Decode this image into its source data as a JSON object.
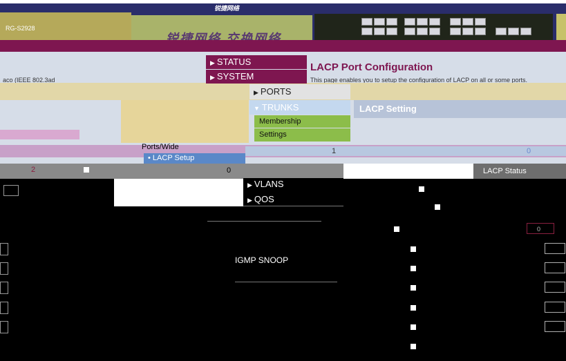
{
  "header": {
    "logo_text": "锐捷网络",
    "brand_text": "锐捷网络 交换网络",
    "product_name": "RG-S2928"
  },
  "page": {
    "title": "LACP Port Configuration",
    "description": "This page enables you to setup the configuration of LACP on all or some ports.",
    "left_description": "aco (IEEE 802.3ad",
    "section_title": "LACP Setting",
    "lacp_status_label": "LACP Status",
    "ports_label": "Ports/Wide",
    "row_num": "2",
    "row_zero": "0",
    "row_one": "1",
    "row_zero_b": "0",
    "val_box": "0"
  },
  "menu": {
    "status": "STATUS",
    "system": "SYSTEM",
    "ports": "PORTS",
    "trunks": "TRUNKS",
    "membership": "Membership",
    "settings": "Settings",
    "lacp_setup": "LACP Setup",
    "vlans": "VLANS",
    "qos": "QOS",
    "igmp": "IGMP SNOOP"
  },
  "colors": {
    "maroon": "#7e1650",
    "menu_green": "#8cbd4a",
    "header_navy": "#2a2d6a"
  }
}
